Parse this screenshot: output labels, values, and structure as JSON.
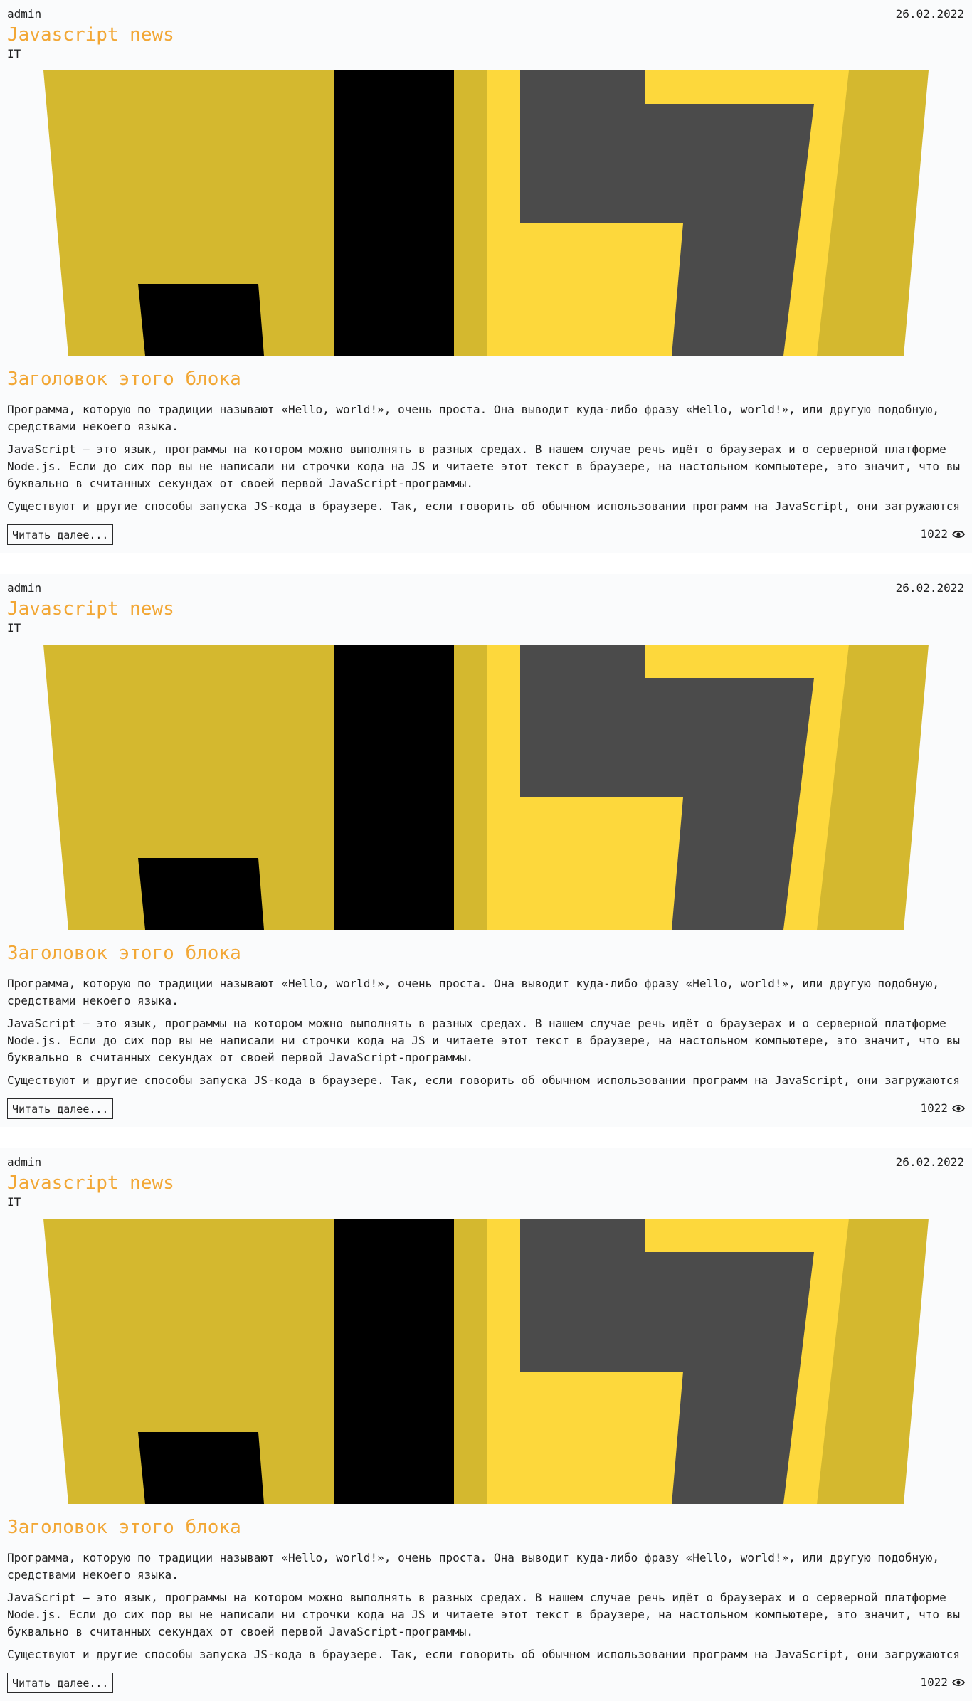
{
  "posts": [
    {
      "author": "admin",
      "date": "26.02.2022",
      "title": "Javascript news",
      "category": "IT",
      "image_icon": "javascript-logo",
      "subtitle": "Заголовок этого блока",
      "paragraphs": [
        "Программа, которую по традиции называют «Hello, world!», очень проста. Она выводит куда-либо фразу «Hello, world!», или другую подобную, средствами некоего языка.",
        "JavaScript — это язык, программы на котором можно выполнять в разных средах. В нашем случае речь идёт о браузерах и о серверной платформе Node.js. Если до сих пор вы не написали ни строчки кода на JS и читаете этот текст в браузере, на настольном компьютере, это значит, что вы буквально в считанных секундах от своей первой JavaScript-программы.",
        "Существуют и другие способы запуска JS-кода в браузере. Так, если говорить об обычном использовании программ на JavaScript, они загружаются"
      ],
      "read_more_label": "Читать далее...",
      "views": "1022",
      "views_icon": "eye-icon"
    },
    {
      "author": "admin",
      "date": "26.02.2022",
      "title": "Javascript news",
      "category": "IT",
      "image_icon": "javascript-logo",
      "subtitle": "Заголовок этого блока",
      "paragraphs": [
        "Программа, которую по традиции называют «Hello, world!», очень проста. Она выводит куда-либо фразу «Hello, world!», или другую подобную, средствами некоего языка.",
        "JavaScript — это язык, программы на котором можно выполнять в разных средах. В нашем случае речь идёт о браузерах и о серверной платформе Node.js. Если до сих пор вы не написали ни строчки кода на JS и читаете этот текст в браузере, на настольном компьютере, это значит, что вы буквально в считанных секундах от своей первой JavaScript-программы.",
        "Существуют и другие способы запуска JS-кода в браузере. Так, если говорить об обычном использовании программ на JavaScript, они загружаются"
      ],
      "read_more_label": "Читать далее...",
      "views": "1022",
      "views_icon": "eye-icon"
    },
    {
      "author": "admin",
      "date": "26.02.2022",
      "title": "Javascript news",
      "category": "IT",
      "image_icon": "javascript-logo",
      "subtitle": "Заголовок этого блока",
      "paragraphs": [
        "Программа, которую по традиции называют «Hello, world!», очень проста. Она выводит куда-либо фразу «Hello, world!», или другую подобную, средствами некоего языка.",
        "JavaScript — это язык, программы на котором можно выполнять в разных средах. В нашем случае речь идёт о браузерах и о серверной платформе Node.js. Если до сих пор вы не написали ни строчки кода на JS и читаете этот текст в браузере, на настольном компьютере, это значит, что вы буквально в считанных секундах от своей первой JavaScript-программы.",
        "Существуют и другие способы запуска JS-кода в браузере. Так, если говорить об обычном использовании программ на JavaScript, они загружаются"
      ],
      "read_more_label": "Читать далее...",
      "views": "1022",
      "views_icon": "eye-icon"
    }
  ],
  "colors": {
    "accent": "#f2a735",
    "logo_dark_yellow": "#d4b82f",
    "logo_bright_yellow": "#fdd83c",
    "logo_black": "#000000",
    "logo_gray": "#4b4b4b"
  }
}
